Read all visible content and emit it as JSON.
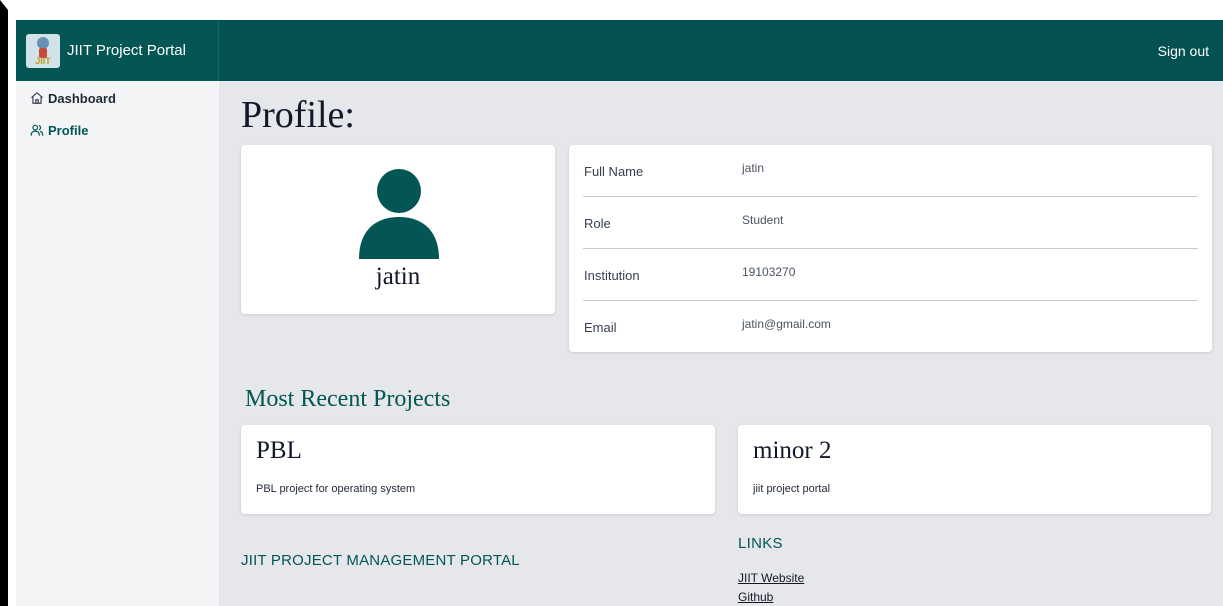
{
  "navbar": {
    "brand": "JIIT Project Portal",
    "logo_text": "JIIT",
    "signout": "Sign out",
    "color": "#035251"
  },
  "sidebar": {
    "items": [
      {
        "label": "Dashboard",
        "icon": "home-icon"
      },
      {
        "label": "Profile",
        "icon": "users-icon",
        "active": true
      }
    ]
  },
  "profile": {
    "title": "Profile:",
    "name": "jatin",
    "fields": [
      {
        "label": "Full Name",
        "value": "jatin"
      },
      {
        "label": "Role",
        "value": "Student"
      },
      {
        "label": "Institution",
        "value": "19103270"
      },
      {
        "label": "Email",
        "value": "jatin@gmail.com"
      }
    ]
  },
  "projects": {
    "title": "Most Recent Projects",
    "items": [
      {
        "title": "PBL",
        "description": "PBL project for operating system"
      },
      {
        "title": "minor 2",
        "description": "jiit project portal"
      }
    ]
  },
  "footer": {
    "title": "JIIT PROJECT MANAGEMENT PORTAL",
    "links_title": "LINKS",
    "links": [
      "JIIT Website",
      "Github"
    ]
  },
  "colors": {
    "brand": "#035654",
    "background": "#e5e7eb",
    "sidebar": "#f3f4f6"
  }
}
